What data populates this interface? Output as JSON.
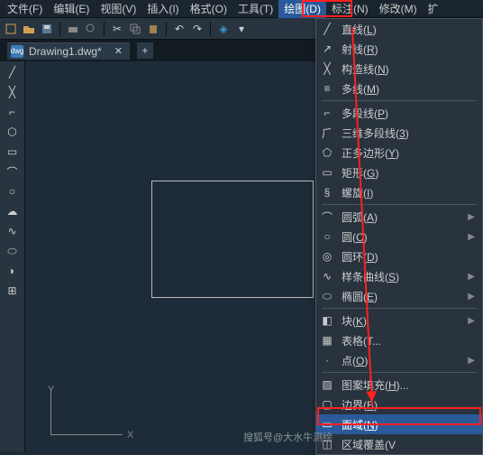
{
  "menubar": [
    "文件(F)",
    "编辑(E)",
    "视图(V)",
    "插入(I)",
    "格式(O)",
    "工具(T)",
    "绘图(D)",
    "标注(N)",
    "修改(M)",
    "扩"
  ],
  "menubar_active": 6,
  "tab": {
    "name": "Drawing1.dwg*",
    "doc": "dwg"
  },
  "dropdown": {
    "items": [
      {
        "icon": "line",
        "txt": "直线(L)"
      },
      {
        "icon": "ray",
        "txt": "射线(R)"
      },
      {
        "icon": "xline",
        "txt": "构造线(N)"
      },
      {
        "icon": "mline",
        "txt": "多线(M)"
      },
      {
        "sep": true
      },
      {
        "icon": "pline",
        "txt": "多段线(P)"
      },
      {
        "icon": "3dpoly",
        "txt": "三维多段线(3)"
      },
      {
        "icon": "polygon",
        "txt": "正多边形(Y)"
      },
      {
        "icon": "rect",
        "txt": "矩形(G)"
      },
      {
        "icon": "helix",
        "txt": "螺旋(I)"
      },
      {
        "sep": true
      },
      {
        "icon": "arc",
        "txt": "圆弧(A)",
        "sub": true
      },
      {
        "icon": "circle",
        "txt": "圆(C)",
        "sub": true
      },
      {
        "icon": "donut",
        "txt": "圆环(D)"
      },
      {
        "icon": "spline",
        "txt": "样条曲线(S)",
        "sub": true
      },
      {
        "icon": "ellipse",
        "txt": "椭圆(E)",
        "sub": true
      },
      {
        "sep": true
      },
      {
        "icon": "block",
        "txt": "块(K)",
        "sub": true
      },
      {
        "icon": "table",
        "txt": "表格(T..."
      },
      {
        "icon": "point",
        "txt": "点(O)",
        "sub": true
      },
      {
        "sep": true
      },
      {
        "icon": "hatch",
        "txt": "图案填充(H)..."
      },
      {
        "icon": "boundary",
        "txt": "边界(B)..."
      },
      {
        "icon": "region",
        "txt": "面域(N)",
        "hl": true
      },
      {
        "icon": "wipeout",
        "txt": "区域覆盖(V"
      }
    ]
  },
  "ucs": {
    "x": "X",
    "y": "Y"
  },
  "watermark": "搜狐号@大水牛测绘"
}
